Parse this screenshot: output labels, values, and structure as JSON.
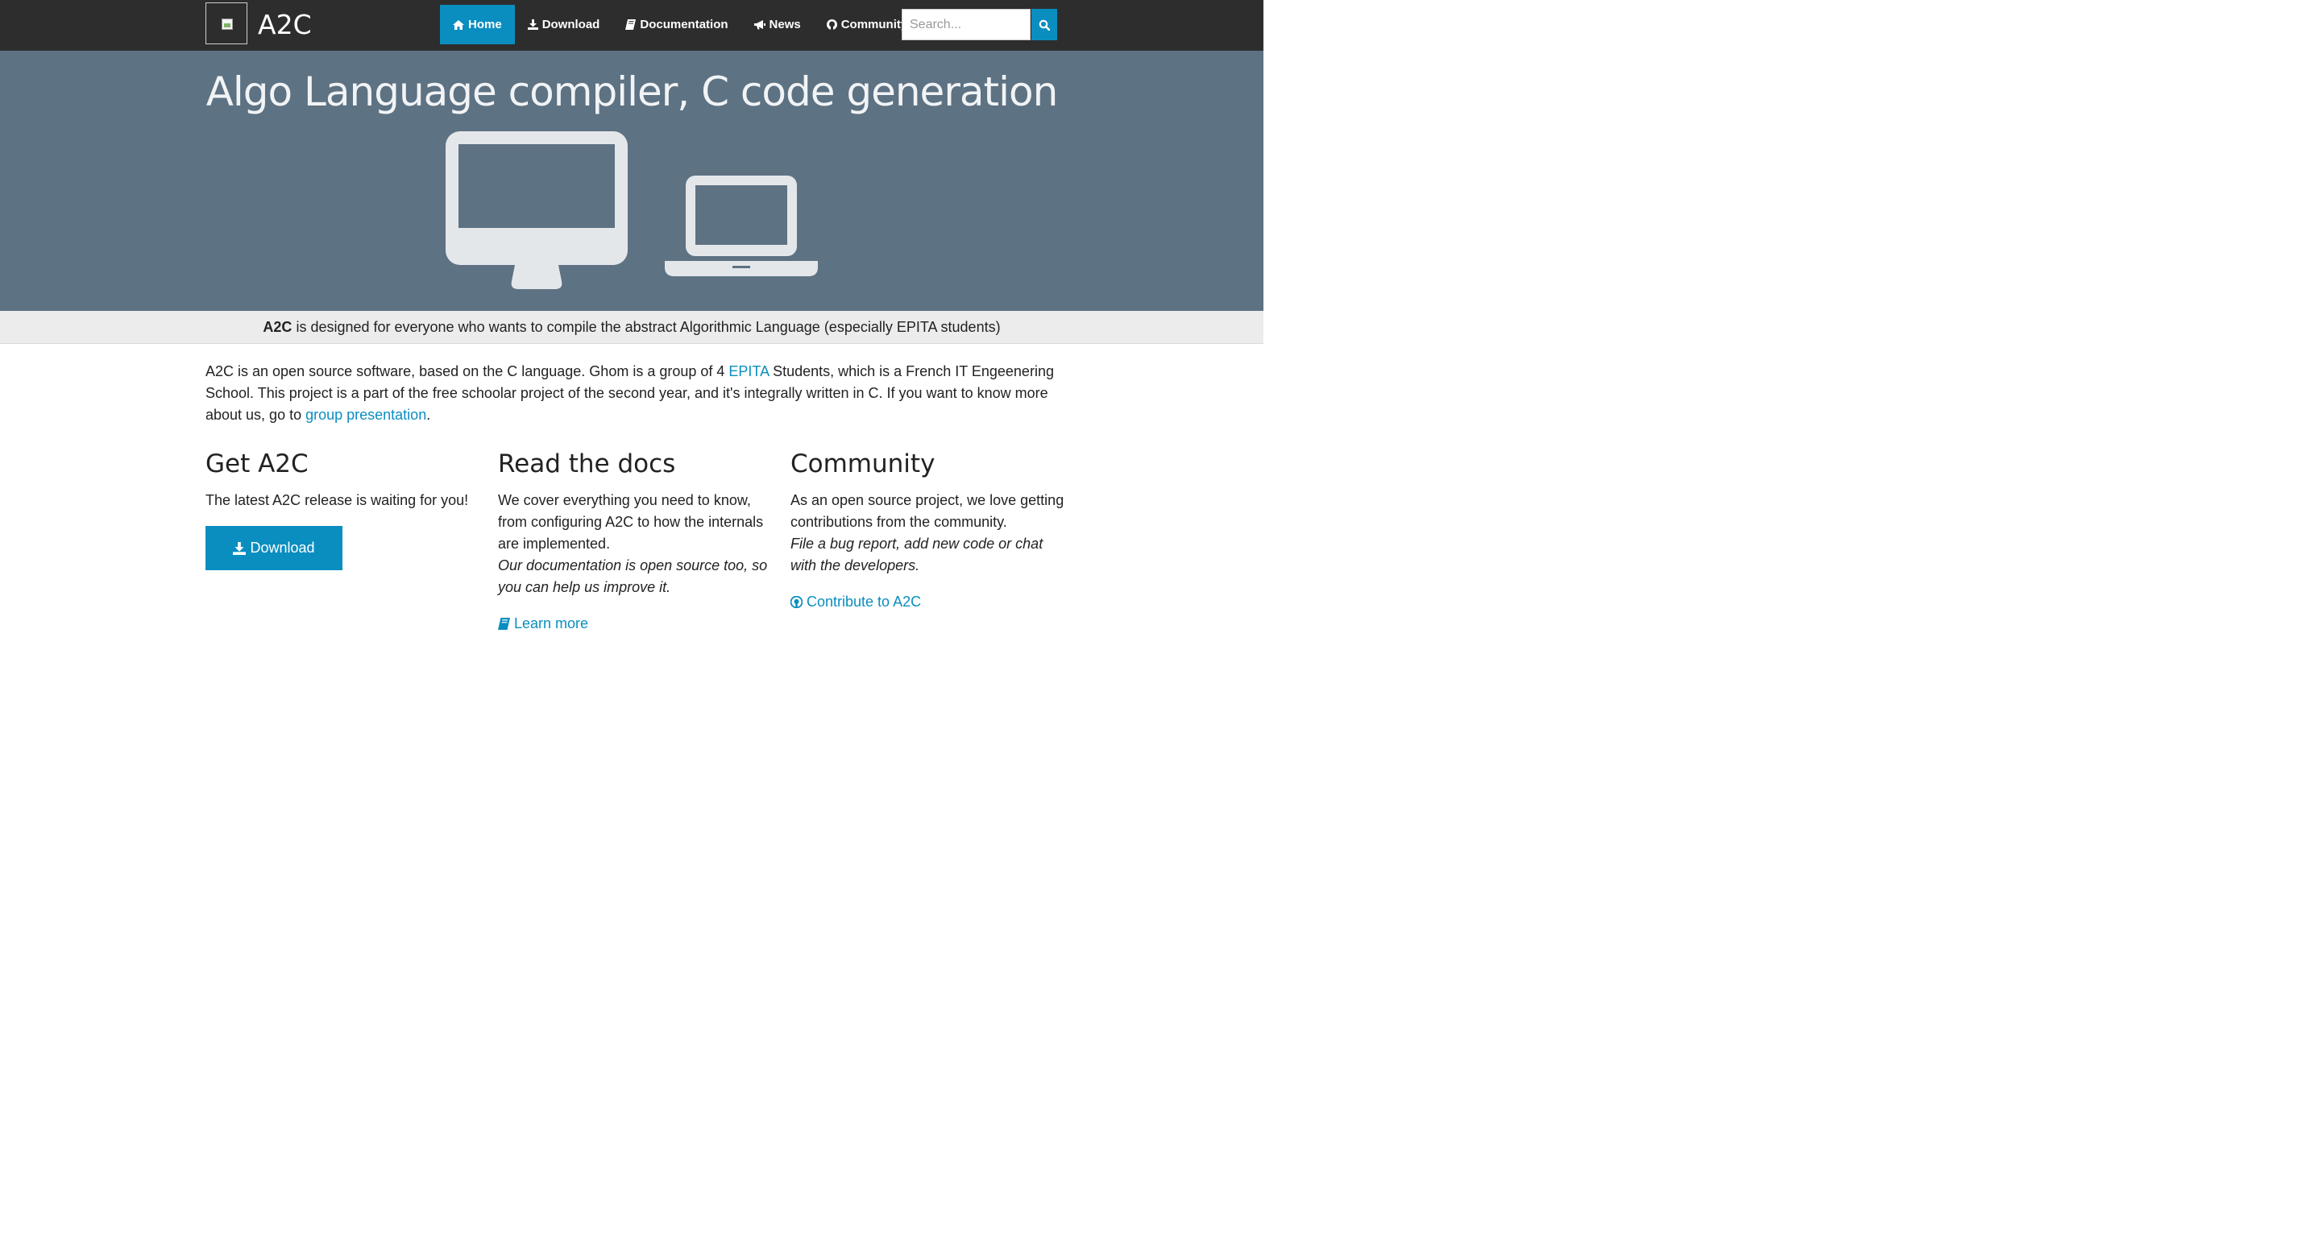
{
  "navbar": {
    "brand": "A2C",
    "items": [
      {
        "label": "Home",
        "icon": "home-icon",
        "active": true
      },
      {
        "label": "Download",
        "icon": "download-icon"
      },
      {
        "label": "Documentation",
        "icon": "book-icon"
      },
      {
        "label": "News",
        "icon": "bullhorn-icon"
      },
      {
        "label": "Community",
        "icon": "github-icon"
      }
    ],
    "search_placeholder": "Search...",
    "search_icon": "search-icon"
  },
  "hero": {
    "title": "Algo Language compiler, C code generation",
    "illustration_icons": [
      "desktop-icon",
      "laptop-icon"
    ]
  },
  "tagline": {
    "bold": "A2C",
    "text": " is designed for everyone who wants to compile the abstract Algorithmic Language (especially EPITA students)"
  },
  "intro": {
    "part1": "A2C is an open source software, based on the C language. Ghom is a group of 4 ",
    "link1": "EPITA",
    "part2": " Students, which is a French IT Engeenering School. This project is a part of the free schoolar project of the second year, and it's integrally written in C. If you want to know more about us, go to ",
    "link2": "group presentation",
    "part3": "."
  },
  "columns": {
    "get": {
      "title": "Get A2C",
      "text": "The latest A2C release is waiting for you!",
      "button_label": "Download"
    },
    "docs": {
      "title": "Read the docs",
      "text": "We cover everything you need to know, from configuring A2C to how the internals are implemented.",
      "italic": "Our documentation is open source too, so you can help us improve it.",
      "link_label": "Learn more"
    },
    "community": {
      "title": "Community",
      "text": "As an open source project, we love getting contributions from the community.",
      "italic": "File a bug report, add new code or chat with the developers.",
      "link_label": "Contribute to A2C"
    }
  },
  "colors": {
    "accent": "#0a8ec0",
    "navbar_bg": "#2d2d2d",
    "hero_bg": "#5d7283",
    "tagline_bg": "#ececec"
  }
}
